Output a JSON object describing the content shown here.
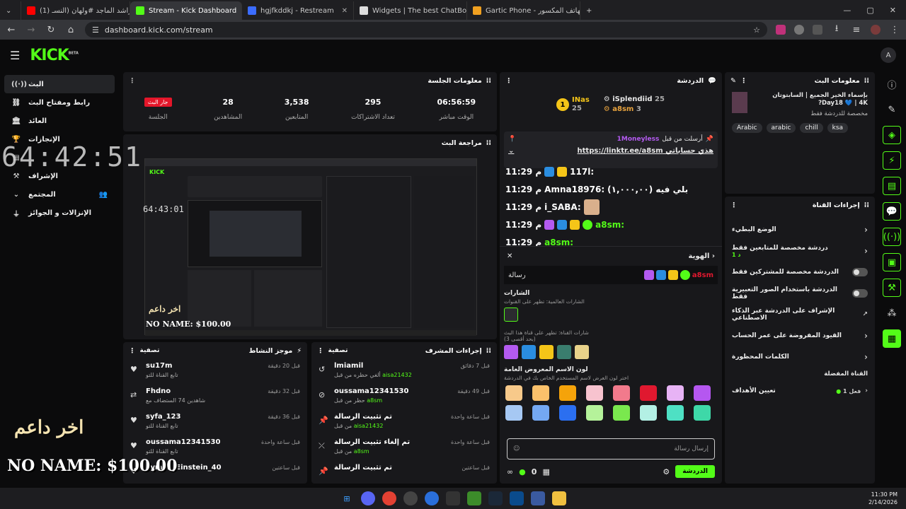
{
  "browser": {
    "tabs": [
      {
        "label": "(1) راشد الماجد #ولهان (النسـ",
        "favicon_color": "#ff0000"
      },
      {
        "label": "Stream - Kick Dashboard",
        "favicon_color": "#53fc18"
      },
      {
        "label": "hgjfkddkj - Restream",
        "favicon_color": "#3b6cff"
      },
      {
        "label": "Widgets | The best ChatBot and",
        "favicon_color": "#dddddd"
      },
      {
        "label": "Gartic Phone - الهاتف المكسور",
        "favicon_color": "#f0a020"
      }
    ],
    "url": "dashboard.kick.com/stream"
  },
  "app": {
    "logo": "KICK",
    "logo_sup": "BETA"
  },
  "leftnav": {
    "items": [
      {
        "label": "البث",
        "icon": "live-icon"
      },
      {
        "label": "رابط ومفتاح البث",
        "icon": "link-icon"
      },
      {
        "label": "العائد",
        "icon": "bank-icon"
      },
      {
        "label": "الإنجازات",
        "icon": "trophy-icon"
      },
      {
        "label": "",
        "icon": "chat-icon"
      },
      {
        "label": "الإشراف",
        "icon": "hammer-icon"
      },
      {
        "label": "المجتمع",
        "icon": "community-icon"
      },
      {
        "label": "الإنزالات و الجوائز",
        "icon": "drops-icon"
      }
    ]
  },
  "session": {
    "title": "معلومات الجلسة",
    "live_badge": "جار البث",
    "stats": [
      {
        "value": "",
        "label": "الجلسة"
      },
      {
        "value": "28",
        "label": "المشاهدين"
      },
      {
        "value": "3,538",
        "label": "المتابعين"
      },
      {
        "value": "295",
        "label": "تعداد الاشتراكات"
      },
      {
        "value": "06:56:59",
        "label": "الوقت مباشر"
      }
    ]
  },
  "preview": {
    "title": "مراجعة البث"
  },
  "activity": {
    "title": "موجز النشاط",
    "filter": "تصفية",
    "items": [
      {
        "name": "su17m",
        "sub": "تابع القناة للتو",
        "time": "قبل 20 دقيقة",
        "icon": "heart-icon"
      },
      {
        "name": "Fhdno",
        "sub": "شاهدين 74 الستضاف مع",
        "time": "قبل 32 دقيقة",
        "icon": "host-icon"
      },
      {
        "name": "syfa_123",
        "sub": "تابع القناة للتو",
        "time": "قبل 36 دقيقة",
        "icon": "heart-icon"
      },
      {
        "name": "oussama12341530",
        "sub": "تابع القناة للتو",
        "time": "قبل ساعة واحدة",
        "icon": "heart-icon"
      },
      {
        "name": "ayman_Einstein_40",
        "sub": "",
        "time": "قبل ساعتين",
        "icon": "heart-icon"
      }
    ]
  },
  "modactions": {
    "title": "إجراءات المشرف",
    "filter": "تصفية",
    "items": [
      {
        "name": "lmiamil",
        "sub_pre": "ألغي حظره من قبل",
        "by": "aisa21432",
        "time": "قبل 7 دقائق",
        "icon": "undo-icon"
      },
      {
        "name": "oussama12341530",
        "sub_pre": "حظر من قبل",
        "by": "a8sm",
        "time": "قبل 49 دقيقة",
        "icon": "ban-icon"
      },
      {
        "name": "تم تثبيت الرسالة",
        "sub_pre": "من قبل",
        "by": "aisa21432",
        "time": "قبل ساعة واحدة",
        "icon": "pin-icon"
      },
      {
        "name": "تم إلغاء تثبيت الرسالة",
        "sub_pre": "من قبل",
        "by": "a8sm",
        "time": "قبل ساعة واحدة",
        "icon": "unpin-icon"
      },
      {
        "name": "تم تثبيت الرسالة",
        "sub_pre": "من قبل",
        "by": "",
        "time": "قبل ساعتين",
        "icon": "pin-icon"
      }
    ]
  },
  "chat": {
    "title": "الدردشة",
    "leaderboard": [
      {
        "name": "INas",
        "count": "25",
        "rank": "1"
      },
      {
        "name": "iSplendiid",
        "count": "25"
      },
      {
        "name": "a8sm",
        "count": "3"
      }
    ],
    "pinned": {
      "by": "1Moneyless",
      "label": "أرسلت من قبل",
      "text": "هذي حساباتي https://linktr.ee/a8sm"
    },
    "messages": [
      {
        "time": "11:29 م",
        "user": "117l:",
        "text": ""
      },
      {
        "time": "11:29 م",
        "user": "Amna18976:",
        "text": "بلي فيه (١,٠٠٠,٠٠)"
      },
      {
        "time": "11:29 م",
        "user": "i_SABA:",
        "text": ""
      },
      {
        "time": "11:29 م",
        "user": "a8sm:",
        "text": ""
      },
      {
        "time": "11:29 م",
        "user": "a8sm:",
        "text": ""
      }
    ],
    "identity": {
      "title": "الهوية",
      "preview_user": "a8sm",
      "preview_text": "رسالة",
      "badges_title": "الشارات",
      "badges_global": "الشارات العالمية: تظهر على القنوات",
      "badges_channel": "شارات القناة: تظهر على قناة هذا البث",
      "badges_max": "(بحد أقصى 3)",
      "name_color_title": "لون الاسم المعروض العامة",
      "name_color_hint": "اختر لون العرض لاسم المستخدم الخاص بك في الدردشة",
      "colors": [
        "#f7c98a",
        "#fbc16b",
        "#f5a30a",
        "#f7c3cf",
        "#f27a8c",
        "#e0182f",
        "#e7b3f5",
        "#b557f0",
        "#a6c8f3",
        "#74a8f2",
        "#2b6ff0",
        "#b5f29a",
        "#7ae84e",
        "#b3f0e4",
        "#4ee0c4",
        "#3ed8a8"
      ]
    },
    "input_placeholder": "إرسال رسالة",
    "send_label": "الدردشة",
    "viewers_count": "0"
  },
  "streaminfo": {
    "title": "معلومات البث",
    "stream_title": "بإسماء الخير الجميع | السابتوتان Day18 💙 | 4K?",
    "category": "مخصصة للدردشة فقط",
    "tags": [
      "Arabic",
      "arabic",
      "chill",
      "ksa"
    ]
  },
  "channelactions": {
    "title": "إجراءات القناة",
    "rows": [
      {
        "label": "الوضع البطيء",
        "type": "chev",
        "sub": ""
      },
      {
        "label": "دردشة مخصصة للمتابعين فقط",
        "type": "chev",
        "sub": "1 د"
      },
      {
        "label": "الدردشة مخصصة للمشتركين فقط",
        "type": "toggle",
        "sub": ""
      },
      {
        "label": "الدردشة باستخدام الصور التعبيرية فقط",
        "type": "toggle",
        "sub": ""
      },
      {
        "label": "الإشراف على الدردشة عبر الذكاء الاصطناعي",
        "type": "ext",
        "sub": ""
      },
      {
        "label": "القيود المفروضة على عمر الحساب",
        "type": "chev",
        "sub": ""
      },
      {
        "label": "الكلمات المحظورة",
        "type": "chev",
        "sub": ""
      }
    ],
    "fav_title": "القناة المفضلة",
    "fav_row": "تعيين الأهداف",
    "fav_status": "فعل 1"
  },
  "overlays": {
    "timer_big": "64:42:51",
    "timer_small": "64:43:01",
    "gold_text": "اخر داعم",
    "white_text": "NO NAME: $100.00"
  },
  "taskbar": {
    "time": "11:30 PM",
    "date": "2/14/2026"
  }
}
